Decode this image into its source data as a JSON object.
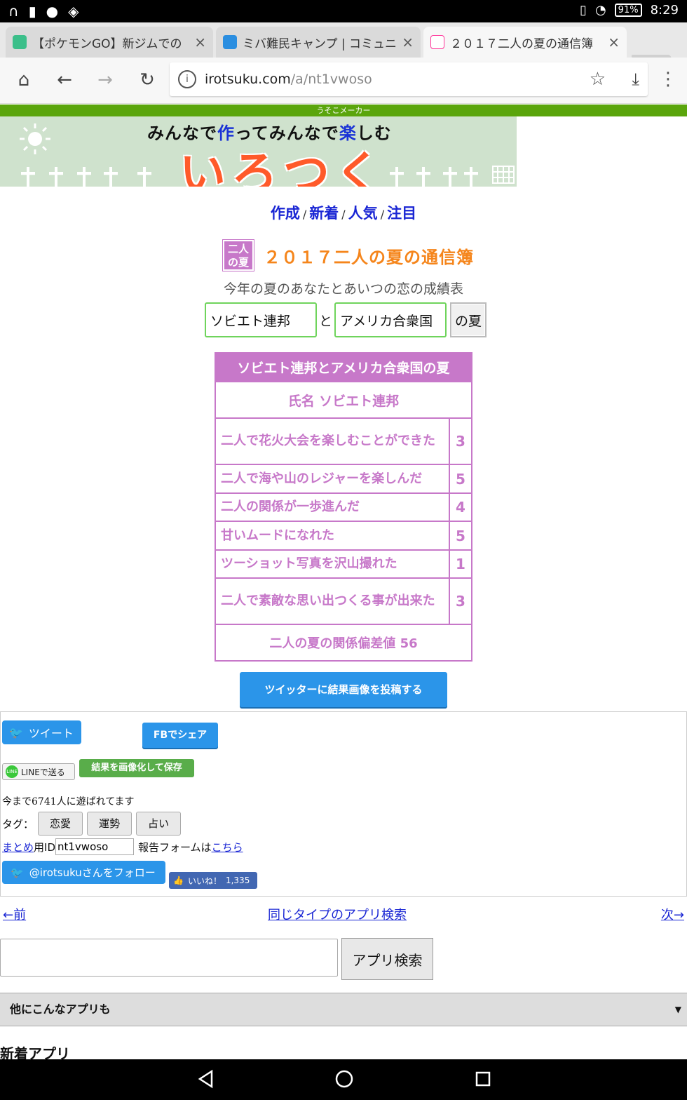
{
  "status_bar": {
    "time": "8:29",
    "battery": "91%"
  },
  "tabs": [
    {
      "title": "【ポケモンGO】新ジムでの",
      "active": false
    },
    {
      "title": "ミバ難民キャンプ | コミュニ",
      "active": false
    },
    {
      "title": "２０１７二人の夏の通信簿",
      "active": true
    }
  ],
  "address": {
    "domain": "irotsuku.com",
    "path": "/a/nt1vwoso"
  },
  "site": {
    "top_label": "うそこメーカー",
    "slogan_parts": [
      "みんなで",
      "作",
      "ってみんなで",
      "楽",
      "しむ"
    ],
    "logo": "いろつく"
  },
  "nav": [
    "作成",
    "新着",
    "人気",
    "注目"
  ],
  "app": {
    "icon_text_1": "二人",
    "icon_text_2": "の夏",
    "title": "２０１７二人の夏の通信簿",
    "subtitle": "今年の夏のあなたとあいつの恋の成績表",
    "name1": "ソビエト連邦",
    "connector": "と",
    "name2": "アメリカ合衆国",
    "submit": "の夏"
  },
  "result": {
    "header": "ソビエト連邦とアメリカ合衆国の夏",
    "name_line": "氏名 ソビエト連邦",
    "items": [
      {
        "label": "二人で花火大会を楽しむことができた",
        "score": "3"
      },
      {
        "label": "二人で海や山のレジャーを楽しんだ",
        "score": "5"
      },
      {
        "label": "二人の関係が一歩進んだ",
        "score": "4"
      },
      {
        "label": "甘いムードになれた",
        "score": "5"
      },
      {
        "label": "ツーショット写真を沢山撮れた",
        "score": "1"
      },
      {
        "label": "二人で素敵な思い出つくる事が出来た",
        "score": "3"
      }
    ],
    "footer": "二人の夏の関係偏差値 56"
  },
  "post_twitter_image": "ツイッターに結果画像を投稿する",
  "share": {
    "tweet": "ツイート",
    "fb_share": "FBでシェア",
    "line": "LINEで送る",
    "save_image": "結果を画像化して保存",
    "played": "今まで6741人に遊ばれてます",
    "tags_label": "タグ：",
    "tags": [
      "恋愛",
      "運勢",
      "占い"
    ],
    "matome": "まとめ",
    "id_label": "用ID",
    "id_value": "nt1vwoso",
    "report_text": "報告フォームは",
    "report_link": "こちら",
    "follow": "@irotsukuさんをフォロー",
    "like": "いいね！",
    "like_count": "1,335"
  },
  "pager": {
    "prev": "←前",
    "same_type": "同じタイプのアプリ検索",
    "next": "次→"
  },
  "search_button": "アプリ検索",
  "others_label": "他にこんなアプリも",
  "new_apps_label": "新着アプリ",
  "colors": {
    "accent_purple": "#c778c9",
    "title_orange": "#f5851b",
    "link_blue": "#1a26d4",
    "green_bar": "#5aa50c"
  }
}
